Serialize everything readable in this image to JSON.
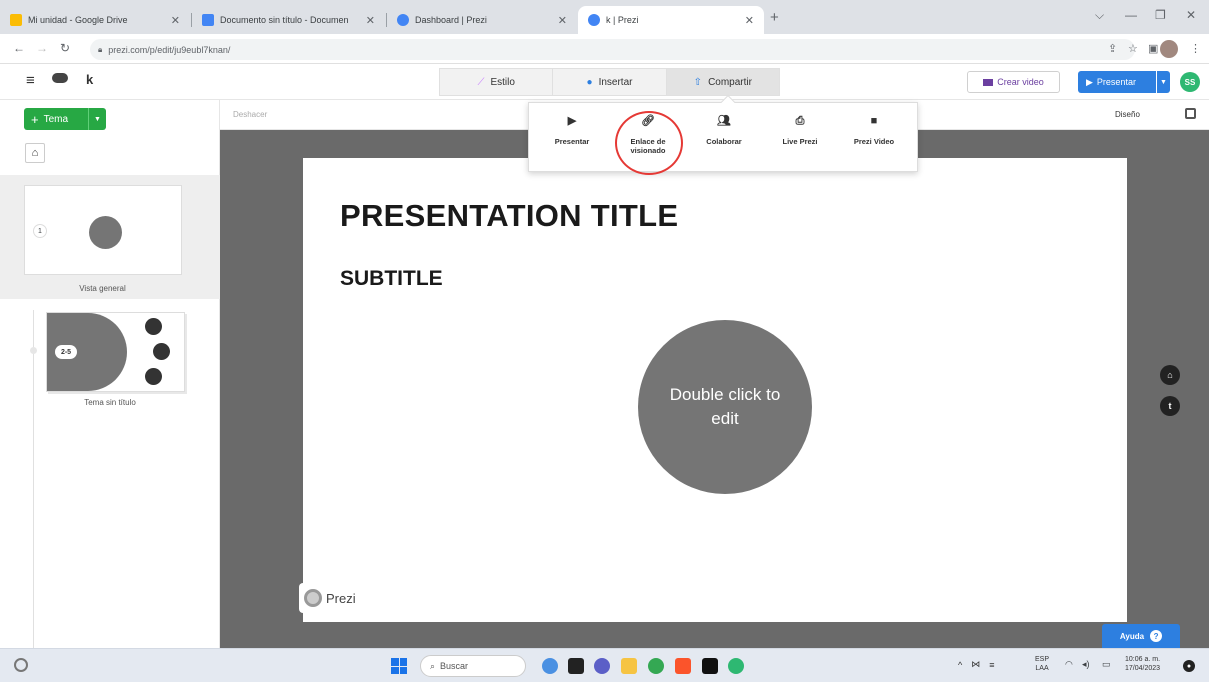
{
  "browser": {
    "tabs": [
      {
        "title": "Mi unidad - Google Drive",
        "favicon_color": "#fbbc04"
      },
      {
        "title": "Documento sin título - Documen",
        "favicon_color": "#4285f4"
      },
      {
        "title": "Dashboard | Prezi",
        "favicon_color": "#4285f4"
      },
      {
        "title": "k | Prezi",
        "favicon_color": "#4285f4"
      }
    ],
    "active_tab_index": 3,
    "url": "prezi.com/p/edit/ju9eubl7knan/"
  },
  "prezi": {
    "title": "k",
    "top_tabs": [
      {
        "label": "Estilo",
        "icon": "magic-wand-icon"
      },
      {
        "label": "Insertar",
        "icon": "insert-plus-icon"
      },
      {
        "label": "Compartir",
        "icon": "share-upload-icon"
      }
    ],
    "active_top_tab": "Compartir",
    "crear_video": "Crear video",
    "presentar": "Presentar",
    "avatar_initials": "SS",
    "deshacer": "Deshacer",
    "diseno": "Diseño",
    "tema_button": "Tema",
    "share_menu": [
      {
        "label": "Presentar",
        "icon": "play-icon"
      },
      {
        "label": "Enlace de visionado",
        "icon": "link-icon"
      },
      {
        "label": "Colaborar",
        "icon": "people-icon"
      },
      {
        "label": "Live Prezi",
        "icon": "broadcast-icon"
      },
      {
        "label": "Prezi Video",
        "icon": "video-camera-icon"
      }
    ],
    "highlighted_share_item": "Enlace de visionado",
    "sidebar": {
      "overview": {
        "number": "1",
        "label": "Vista general"
      },
      "topic": {
        "number": "2-5",
        "label": "Tema sin título"
      }
    },
    "slide": {
      "title": "PRESENTATION TITLE",
      "subtitle": "SUBTITLE",
      "topic_placeholder": "Double click to edit"
    },
    "logo_text": "Prezi",
    "right_buttons": [
      {
        "icon": "home-icon"
      },
      {
        "icon": "text-t-icon"
      }
    ],
    "ayuda": "Ayuda"
  },
  "taskbar": {
    "search_placeholder": "Buscar",
    "language": "ESP",
    "language_sub": "LAA",
    "time": "10:06 a. m.",
    "date": "17/04/2023"
  },
  "colors": {
    "accent_blue": "#2d7fe0",
    "tema_green": "#27a844",
    "topic_gray": "#757575",
    "canvas_bg": "#6a6a6a",
    "highlight_red": "#e53935"
  }
}
